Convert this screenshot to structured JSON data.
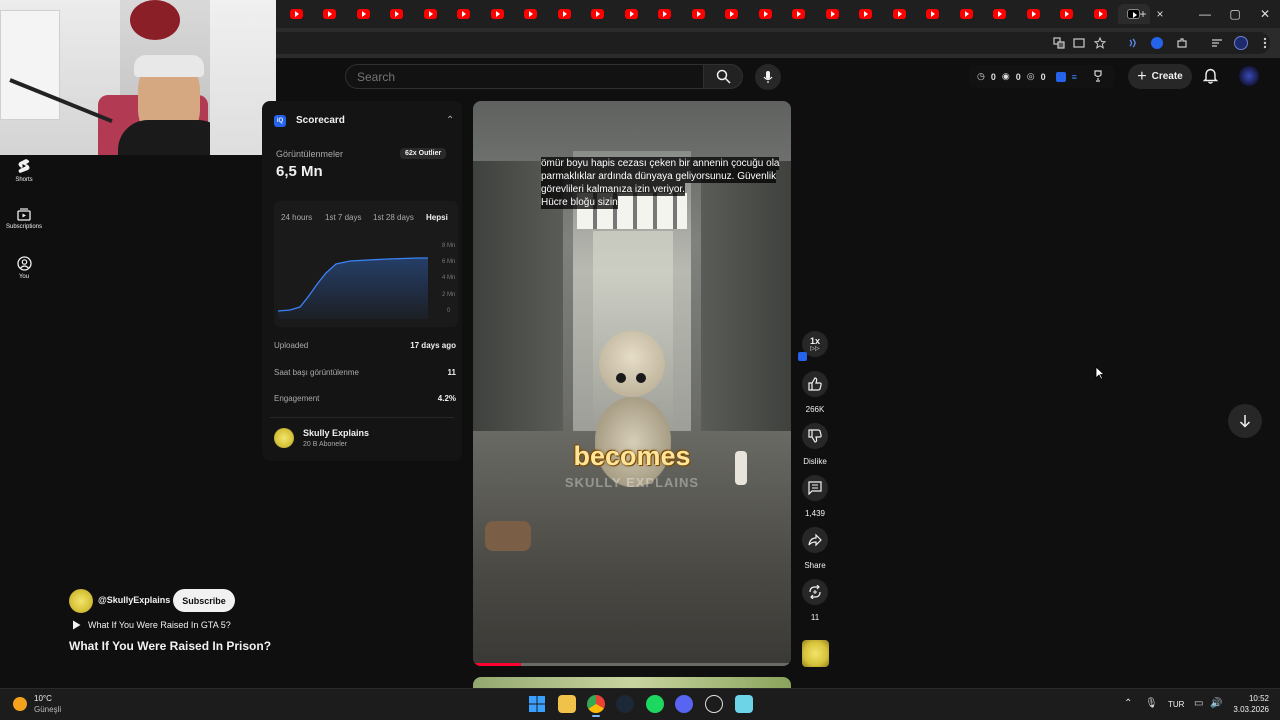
{
  "browser": {
    "tab_count": 26,
    "new_tab": "+",
    "close_tab": "×"
  },
  "header": {
    "search": {
      "placeholder": "Search"
    },
    "ext_counts": [
      "0",
      "0",
      "0"
    ],
    "create_label": "Create"
  },
  "nav": {
    "items": [
      {
        "label": "Shorts",
        "icon": "shorts-icon"
      },
      {
        "label": "Subscriptions",
        "icon": "subscriptions-icon"
      },
      {
        "label": "You",
        "icon": "you-icon"
      }
    ]
  },
  "scorecard": {
    "title": "Scorecard",
    "views_label": "Görüntülenmeler",
    "views_value": "6,5 Mn",
    "outlier_badge": "62x Outlier",
    "tabs": [
      "24 hours",
      "1st 7 days",
      "1st 28 days",
      "Hepsi"
    ],
    "active_tab": "Hepsi",
    "chart_ticks": [
      "8 Mn",
      "6 Mn",
      "4 Mn",
      "2 Mn",
      "0"
    ],
    "stats": [
      {
        "label": "Uploaded",
        "value": "17 days ago"
      },
      {
        "label": "Saat başı görüntülenme",
        "value": "11"
      },
      {
        "label": "Engagement",
        "value": "4.2%"
      }
    ],
    "channel_name": "Skully Explains",
    "channel_subs": "20 B Aboneler"
  },
  "video": {
    "caption_lines": [
      "ömür boyu hapis cezası çeken bir annenin çocuğu ola",
      "parmaklıklar ardında dünyaya geliyorsunuz.  Güvenlik",
      "görevlileri kalmanıza izin veriyor.",
      "Hücre bloğu sizin"
    ],
    "overlay_word": "becomes",
    "watermark": "SKULLY EXPLAINS",
    "channel_handle": "@SkullyExplains",
    "subscribe_label": "Subscribe",
    "playlist_title": "What If You Were Raised In GTA 5?",
    "title": "What If You Were Raised In Prison?",
    "progress": 0.15
  },
  "actions": {
    "speed": "1x",
    "likes": "266K",
    "dislike_label": "Dislike",
    "comments": "1,439",
    "share_label": "Share",
    "remix_count": "11"
  },
  "taskbar": {
    "weather_temp": "10°C",
    "weather_desc": "Güneşli",
    "lang": "TUR",
    "time": "10:52",
    "date": "3.03.2026"
  },
  "colors": {
    "accent_red": "#ff0000",
    "chart_blue": "#3b82f6",
    "iq_blue": "#2563eb"
  }
}
